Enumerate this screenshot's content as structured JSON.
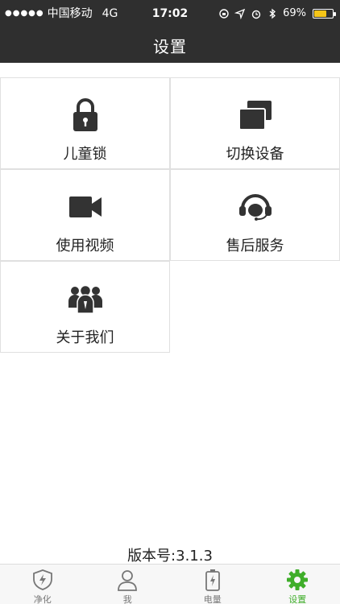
{
  "status_bar": {
    "signal_dots": "●●●●●",
    "carrier": "中国移动",
    "network": "4G",
    "time": "17:02",
    "battery_percent": "69%",
    "battery_level": 0.69
  },
  "nav": {
    "title": "设置"
  },
  "tiles": [
    {
      "label": "儿童锁",
      "icon": "lock-icon"
    },
    {
      "label": "切换设备",
      "icon": "switch-device-icon"
    },
    {
      "label": "使用视频",
      "icon": "video-camera-icon"
    },
    {
      "label": "售后服务",
      "icon": "customer-service-headset-icon"
    },
    {
      "label": "关于我们",
      "icon": "people-group-icon"
    }
  ],
  "version": "版本号:3.1.3",
  "tabs": [
    {
      "label": "净化",
      "icon": "shield-bolt-icon"
    },
    {
      "label": "我",
      "icon": "user-icon"
    },
    {
      "label": "电量",
      "icon": "battery-icon"
    },
    {
      "label": "设置",
      "icon": "gear-icon",
      "active": true
    }
  ],
  "colors": {
    "header_bg": "#2f2f2f",
    "active_tab": "#3fae2a",
    "icon_dark": "#333333"
  }
}
